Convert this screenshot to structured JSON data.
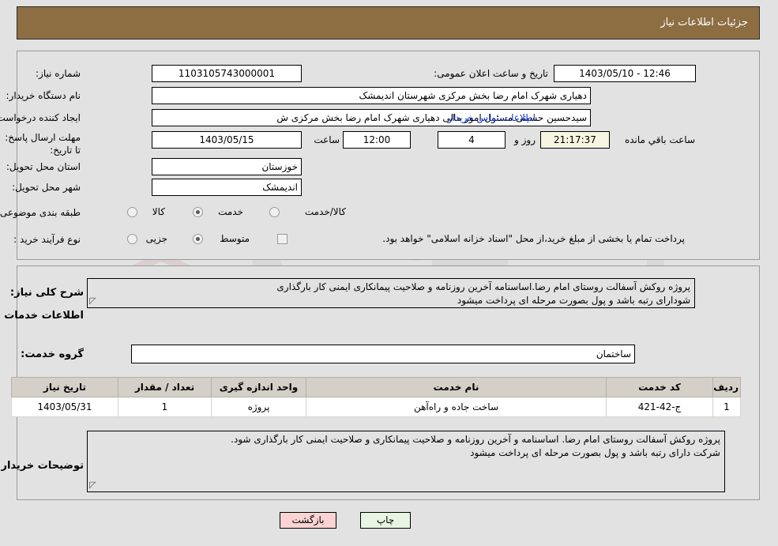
{
  "header": {
    "title": "جزئیات اطلاعات نیاز"
  },
  "colors": {
    "header_bg": "#8d6e43",
    "page_bg": "#e2e2e2",
    "link": "#0a32c8",
    "highlight_field": "#f7f6e2",
    "print_button": "#e7f5e2",
    "back_button": "#fbd3d3"
  },
  "form": {
    "need_number_label": "شماره نیاز:",
    "need_number_value": "1103105743000001",
    "announce_datetime_label": "تاریخ و ساعت اعلان عمومی:",
    "announce_datetime_value": "12:46 - 1403/05/10",
    "buyer_org_label": "نام دستگاه خریدار:",
    "buyer_org_value": "دهیاری شهرک امام رضا بخش مرکزی شهرستان اندیمشک",
    "requester_label": "ایجاد کننده درخواست:",
    "requester_value": "سیدحسین حسینی مسئول امور مالی دهیاری شهرک امام رضا بخش مرکزی ش",
    "buyer_contact_link": "اطلاعات تماس خریدار",
    "deadline_label": "مهلت ارسال پاسخ: تا تاریخ:",
    "deadline_date": "1403/05/15",
    "deadline_hour_label": "ساعت",
    "deadline_hour_value": "12:00",
    "remaining_days_value": "4",
    "remaining_days_suffix": "روز و",
    "remaining_time_value": "21:17:37",
    "remaining_time_suffix": "ساعت باقي مانده",
    "province_label": "استان محل تحویل:",
    "province_value": "خوزستان",
    "city_label": "شهر محل تحویل:",
    "city_value": "اندیمشک",
    "category_label": "طبقه بندی موضوعی:",
    "category_options": [
      "کالا",
      "خدمت",
      "کالا/خدمت"
    ],
    "category_selected": "خدمت",
    "purchase_type_label": "نوع فرآیند خرید :",
    "purchase_type_options": [
      "جزیی",
      "متوسط"
    ],
    "purchase_type_selected": "متوسط",
    "treasury_checkbox_label": "پرداخت تمام یا بخشی از مبلغ خرید،از محل \"اسناد خزانه اسلامی\" خواهد بود.",
    "treasury_checked": false
  },
  "description": {
    "general_need_label": "شرح کلی نیاز:",
    "general_need_line1": "پروژه روکش آسفالت روستای امام رضا.اساسنامه آخرین روزنامه و صلاحیت پیمانکاری ایمنی کار بارگذاری",
    "general_need_line2": "شودارای رتبه باشد و پول بصورت مرحله ای پرداخت میشود",
    "services_section_title": "اطلاعات خدمات مورد نیاز",
    "service_group_label": "گروه خدمت:",
    "service_group_value": "ساختمان",
    "buyer_notes_label": "توضیحات خریدار:",
    "buyer_notes_line1": "پروژه روکش آسفالت روستای امام رضا. اساسنامه و آخرین روزنامه و صلاحیت پیمانکاری و صلاحیت ایمنی کار بارگذاری شود.",
    "buyer_notes_line2": "شرکت دارای رتبه باشد و پول بصورت مرحله ای پرداخت میشود"
  },
  "table": {
    "columns": [
      "ردیف",
      "کد خدمت",
      "نام خدمت",
      "واحد اندازه گیری",
      "تعداد / مقدار",
      "تاریخ نیاز"
    ],
    "rows": [
      {
        "row_no": "1",
        "service_code": "ج-42-421",
        "service_name": "ساخت جاده و راه‌آهن",
        "unit": "پروژه",
        "quantity": "1",
        "need_date": "1403/05/31"
      }
    ]
  },
  "footer": {
    "print_label": "چاپ",
    "back_label": "بازگشت"
  },
  "watermark": {
    "text": "AriaTender.net"
  }
}
